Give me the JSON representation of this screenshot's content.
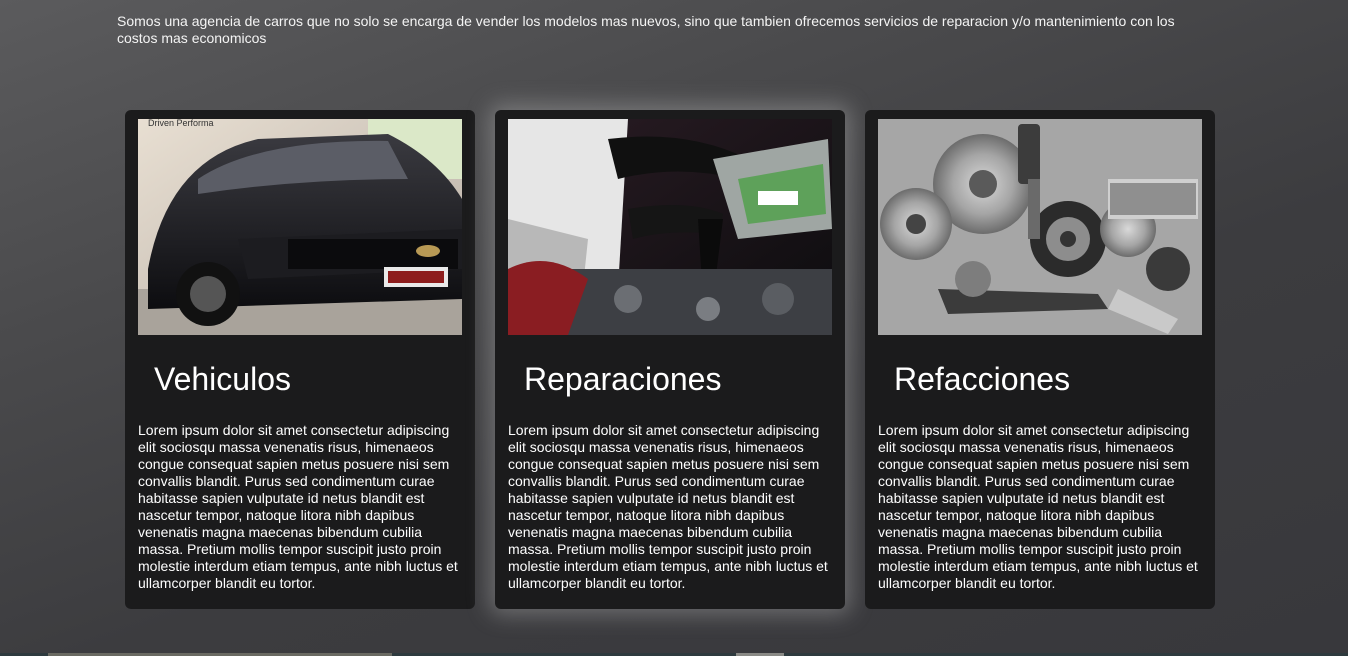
{
  "intro": {
    "text": "Somos una agencia de carros que no solo se encarga de vender los modelos mas nuevos, sino que tambien ofrecemos servicios de reparacion y/o mantenimiento con los costos mas economicos"
  },
  "cards": [
    {
      "title": "Vehiculos",
      "image": "black-sports-car-photo",
      "image_caption": "Driven Performa",
      "text": "Lorem ipsum dolor sit amet consectetur adipiscing elit sociosqu massa venenatis risus, himenaeos congue consequat sapien metus posuere nisi sem convallis blandit. Purus sed condimentum curae habitasse sapien vulputate id netus blandit est nascetur tempor, natoque litora nibh dapibus venenatis magna maecenas bibendum cubilia massa. Pretium mollis tempor suscipit justo proin molestie interdum etiam tempus, ante nibh luctus et ullamcorper blandit eu tortor."
    },
    {
      "title": "Reparaciones",
      "image": "mechanic-pouring-oil-photo",
      "text": "Lorem ipsum dolor sit amet consectetur adipiscing elit sociosqu massa venenatis risus, himenaeos congue consequat sapien metus posuere nisi sem convallis blandit. Purus sed condimentum curae habitasse sapien vulputate id netus blandit est nascetur tempor, natoque litora nibh dapibus venenatis magna maecenas bibendum cubilia massa. Pretium mollis tempor suscipit justo proin molestie interdum etiam tempus, ante nibh luctus et ullamcorper blandit eu tortor."
    },
    {
      "title": "Refacciones",
      "image": "auto-parts-photo",
      "text": "Lorem ipsum dolor sit amet consectetur adipiscing elit sociosqu massa venenatis risus, himenaeos congue consequat sapien metus posuere nisi sem convallis blandit. Purus sed condimentum curae habitasse sapien vulputate id netus blandit est nascetur tempor, natoque litora nibh dapibus venenatis magna maecenas bibendum cubilia massa. Pretium mollis tempor suscipit justo proin molestie interdum etiam tempus, ante nibh luctus et ullamcorper blandit eu tortor."
    }
  ],
  "colors": {
    "card_background": "#1b1b1c",
    "text": "#ffffff"
  }
}
